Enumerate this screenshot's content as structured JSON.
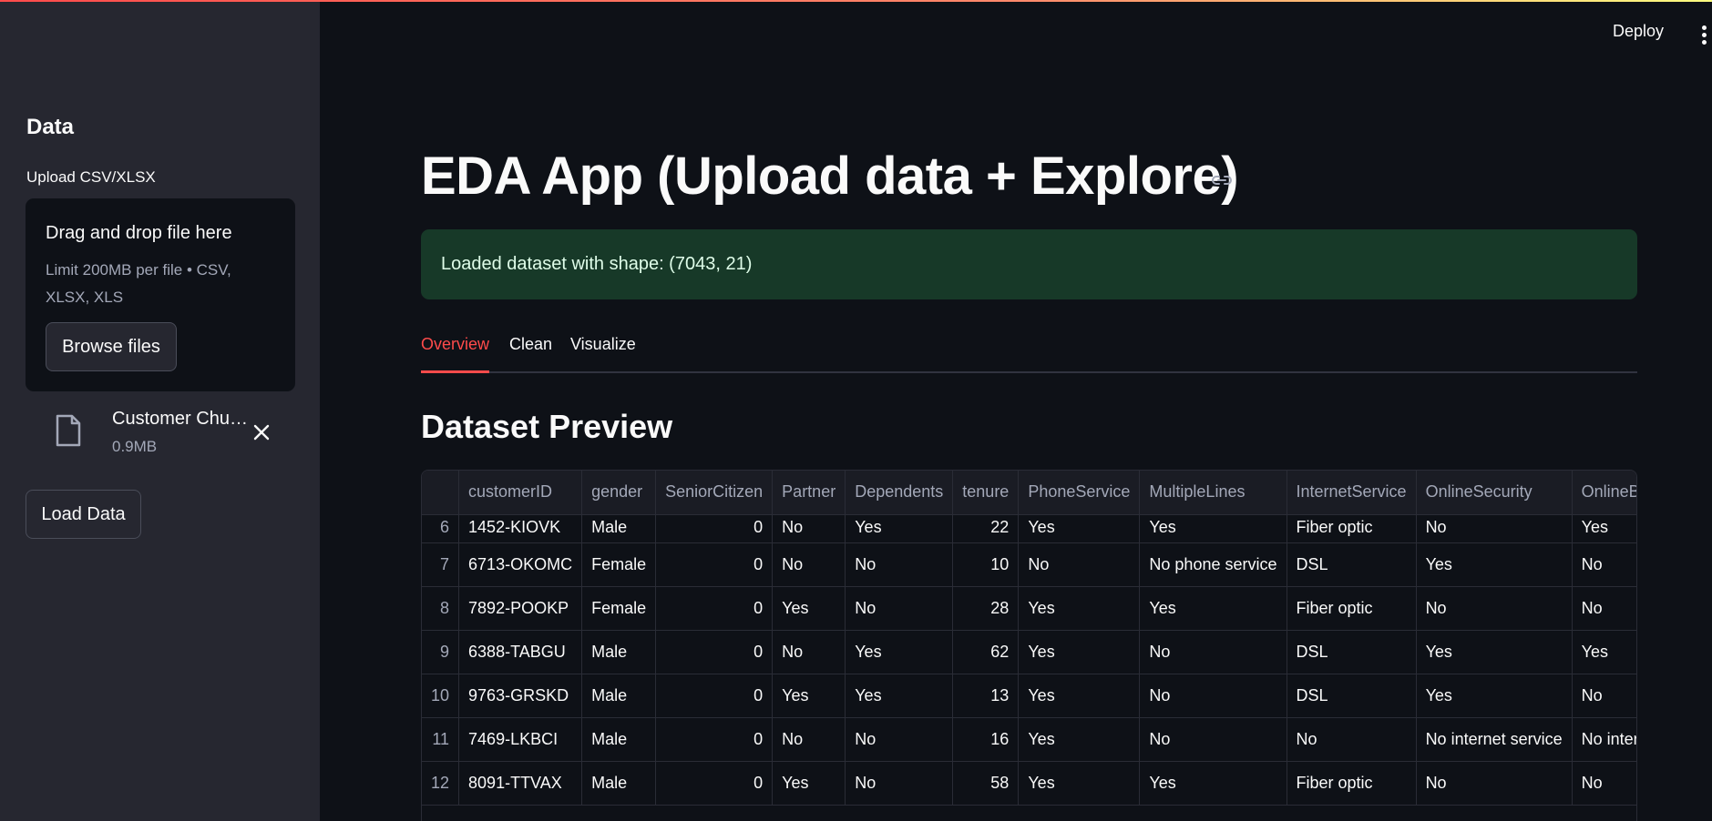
{
  "sidebar": {
    "heading": "Data",
    "upload_label": "Upload CSV/XLSX",
    "dropzone": {
      "title": "Drag and drop file here",
      "limit": "Limit 200MB per file • CSV, XLSX, XLS",
      "browse_label": "Browse files"
    },
    "file": {
      "name": "Customer Churn.csv",
      "size": "0.9MB"
    },
    "load_label": "Load Data"
  },
  "header": {
    "deploy_label": "Deploy"
  },
  "main": {
    "title": "EDA App (Upload data + Explore)",
    "success_message": "Loaded dataset with shape: (7043, 21)",
    "tabs": [
      {
        "label": "Overview",
        "active": true
      },
      {
        "label": "Clean",
        "active": false
      },
      {
        "label": "Visualize",
        "active": false
      }
    ],
    "subheading": "Dataset Preview",
    "table": {
      "columns": [
        "",
        "customerID",
        "gender",
        "SeniorCitizen",
        "Partner",
        "Dependents",
        "tenure",
        "PhoneService",
        "MultipleLines",
        "InternetService",
        "OnlineSecurity",
        "OnlineBackup"
      ],
      "rows": [
        [
          "6",
          "1452-KIOVK",
          "Male",
          "0",
          "No",
          "Yes",
          "22",
          "Yes",
          "Yes",
          "Fiber optic",
          "No",
          "Yes"
        ],
        [
          "7",
          "6713-OKOMC",
          "Female",
          "0",
          "No",
          "No",
          "10",
          "No",
          "No phone service",
          "DSL",
          "Yes",
          "No"
        ],
        [
          "8",
          "7892-POOKP",
          "Female",
          "0",
          "Yes",
          "No",
          "28",
          "Yes",
          "Yes",
          "Fiber optic",
          "No",
          "No"
        ],
        [
          "9",
          "6388-TABGU",
          "Male",
          "0",
          "No",
          "Yes",
          "62",
          "Yes",
          "No",
          "DSL",
          "Yes",
          "Yes"
        ],
        [
          "10",
          "9763-GRSKD",
          "Male",
          "0",
          "Yes",
          "Yes",
          "13",
          "Yes",
          "No",
          "DSL",
          "Yes",
          "No"
        ],
        [
          "11",
          "7469-LKBCI",
          "Male",
          "0",
          "No",
          "No",
          "16",
          "Yes",
          "No",
          "No",
          "No internet service",
          "No internet service"
        ],
        [
          "12",
          "8091-TTVAX",
          "Male",
          "0",
          "Yes",
          "No",
          "58",
          "Yes",
          "Yes",
          "Fiber optic",
          "No",
          "No"
        ]
      ]
    }
  },
  "colors": {
    "accent": "#ff4b4b",
    "success_bg": "#173928",
    "sidebar_bg": "#262730",
    "app_bg": "#0e1117"
  }
}
